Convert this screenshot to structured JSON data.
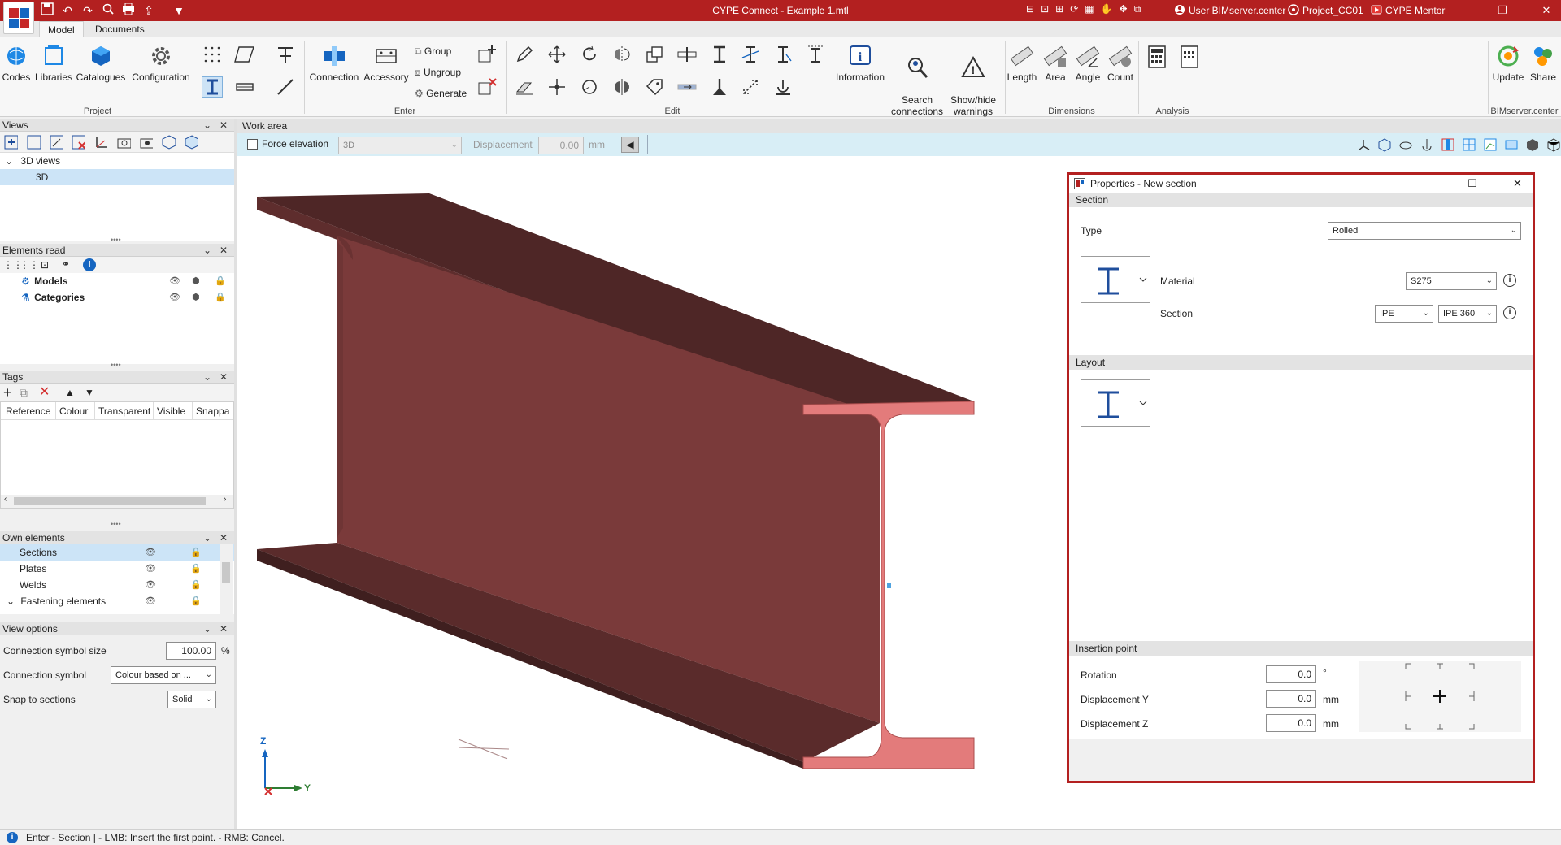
{
  "title_bar": {
    "app_title": "CYPE Connect - Example 1.mtl",
    "user": "User BIMserver.center",
    "project": "Project_CC01",
    "mentor": "CYPE Mentor"
  },
  "menu": {
    "tabs": [
      "Model",
      "Documents"
    ]
  },
  "ribbon": {
    "project": {
      "title": "Project",
      "codes": "Codes",
      "libraries": "Libraries",
      "catalogues": "Catalogues",
      "configuration": "Configuration"
    },
    "enter": {
      "title": "Enter",
      "connection": "Connection",
      "accessory": "Accessory",
      "group": "Group",
      "ungroup": "Ungroup",
      "generate": "Generate"
    },
    "edit": {
      "title": "Edit"
    },
    "info": {
      "information": "Information",
      "search_connections": "Search\nconnections",
      "show_hide_warnings": "Show/hide\nwarnings"
    },
    "dimensions": {
      "title": "Dimensions",
      "length": "Length",
      "area": "Area",
      "angle": "Angle",
      "count": "Count"
    },
    "analysis": {
      "title": "Analysis"
    },
    "bimserver": {
      "title": "BIMserver.center",
      "update": "Update",
      "share": "Share"
    }
  },
  "views": {
    "header": "Views",
    "tree_root": "3D views",
    "tree_child": "3D"
  },
  "elements_read": {
    "header": "Elements read",
    "items": [
      "Models",
      "Categories"
    ]
  },
  "tags": {
    "header": "Tags",
    "columns": [
      "Reference",
      "Colour",
      "Transparent",
      "Visible",
      "Snappa"
    ]
  },
  "own_elements": {
    "header": "Own elements",
    "items": [
      "Sections",
      "Plates",
      "Welds",
      "Fastening elements"
    ]
  },
  "view_options": {
    "header": "View options",
    "connection_symbol_size_label": "Connection symbol size",
    "connection_symbol_size_value": "100.00",
    "connection_symbol_size_unit": "%",
    "connection_symbol_label": "Connection symbol",
    "connection_symbol_value": "Colour based on ...",
    "snap_label": "Snap to sections",
    "snap_value": "Solid"
  },
  "work_area": {
    "header": "Work area",
    "force_elevation": "Force elevation",
    "view_select": "3D",
    "displacement_label": "Displacement",
    "displacement_value": "0.00",
    "displacement_unit": "mm",
    "axis_z": "Z",
    "axis_y": "Y"
  },
  "properties": {
    "title": "Properties - New section",
    "section_header": "Section",
    "type_label": "Type",
    "type_value": "Rolled",
    "material_label": "Material",
    "material_value": "S275",
    "section_label": "Section",
    "section_series": "IPE",
    "section_value": "IPE 360",
    "layout_header": "Layout",
    "insertion_header": "Insertion point",
    "rotation_label": "Rotation",
    "rotation_value": "0.0",
    "rotation_unit": "°",
    "dy_label": "Displacement Y",
    "dy_value": "0.0",
    "dy_unit": "mm",
    "dz_label": "Displacement Z",
    "dz_value": "0.0",
    "dz_unit": "mm"
  },
  "status": {
    "text": "Enter - Section  |  - LMB: Insert the first point. - RMB: Cancel."
  },
  "colors": {
    "brand_red": "#b32020",
    "beam_face": "#7a3a3a",
    "beam_dark": "#4e2626",
    "beam_section": "#e37b7b",
    "accent_blue": "#1f4e9c"
  }
}
